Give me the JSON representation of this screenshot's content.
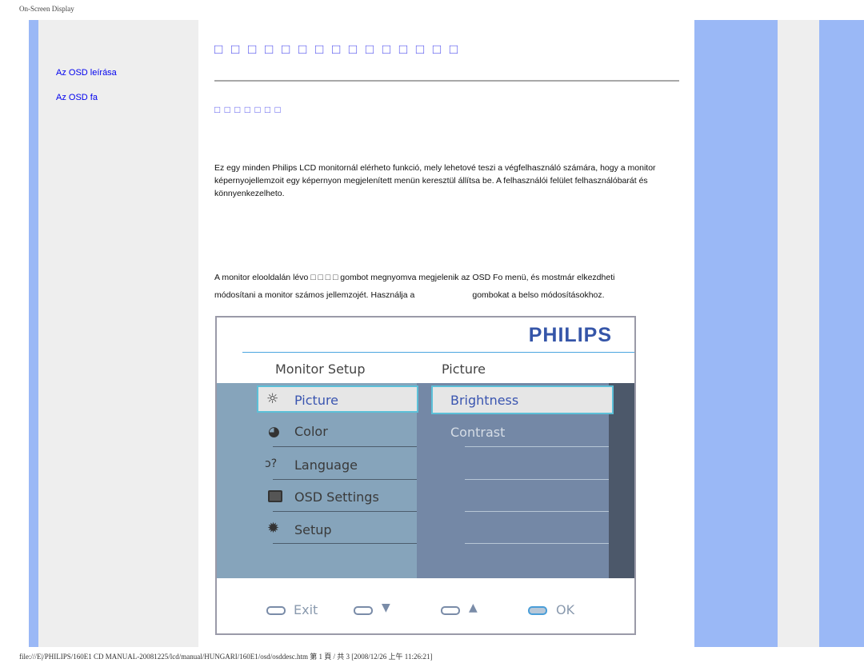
{
  "header": {
    "title": "On-Screen Display"
  },
  "sidebar": {
    "links": [
      {
        "label": "Az OSD leírása"
      },
      {
        "label": "Az OSD fa"
      }
    ]
  },
  "main": {
    "title": "□ □ □ □ □ □ □ □ □ □ □ □ □ □ □",
    "subtitle": "□ □ □ □ □ □ □",
    "para1": "Ez egy minden Philips LCD monitornál elérheto funkció, mely lehetové teszi a végfelhasználó számára, hogy a monitor képernyojellemzoit egy képernyon megjelenített menün keresztül állítsa be. A felhasználói felület felhasználóbarát és könnyenkezelheto.",
    "para2a": "A monitor elooldalán lévo",
    "para2_boxes": "□ □ □ □",
    "para2b": "gombot megnyomva megjelenik az OSD Fo menü, és mostmár elkezdheti",
    "para3a": "módosítani a monitor számos jellemzojét. Használja a",
    "para3b": "gombokat a belso módosításokhoz."
  },
  "osd": {
    "brand": "PHILIPS",
    "left_header": "Monitor Setup",
    "right_header": "Picture",
    "menu": [
      {
        "label": "Picture",
        "icon": "sun-icon"
      },
      {
        "label": "Color",
        "icon": "palette-icon"
      },
      {
        "label": "Language",
        "icon": "speech-icon"
      },
      {
        "label": "OSD Settings",
        "icon": "screen-icon"
      },
      {
        "label": "Setup",
        "icon": "gear-icon"
      }
    ],
    "submenu": [
      {
        "label": "Brightness"
      },
      {
        "label": "Contrast"
      }
    ],
    "buttons": [
      {
        "label": "Exit"
      },
      {
        "label": "▼"
      },
      {
        "label": "▲"
      },
      {
        "label": "OK"
      }
    ]
  },
  "footer": {
    "path": "file:///E|/PHILIPS/160E1 CD MANUAL-20081225/lcd/manual/HUNGARI/160E1/osd/osddesc.htm 第 1 頁 / 共 3 [2008/12/26 上午 11:26:21]"
  }
}
